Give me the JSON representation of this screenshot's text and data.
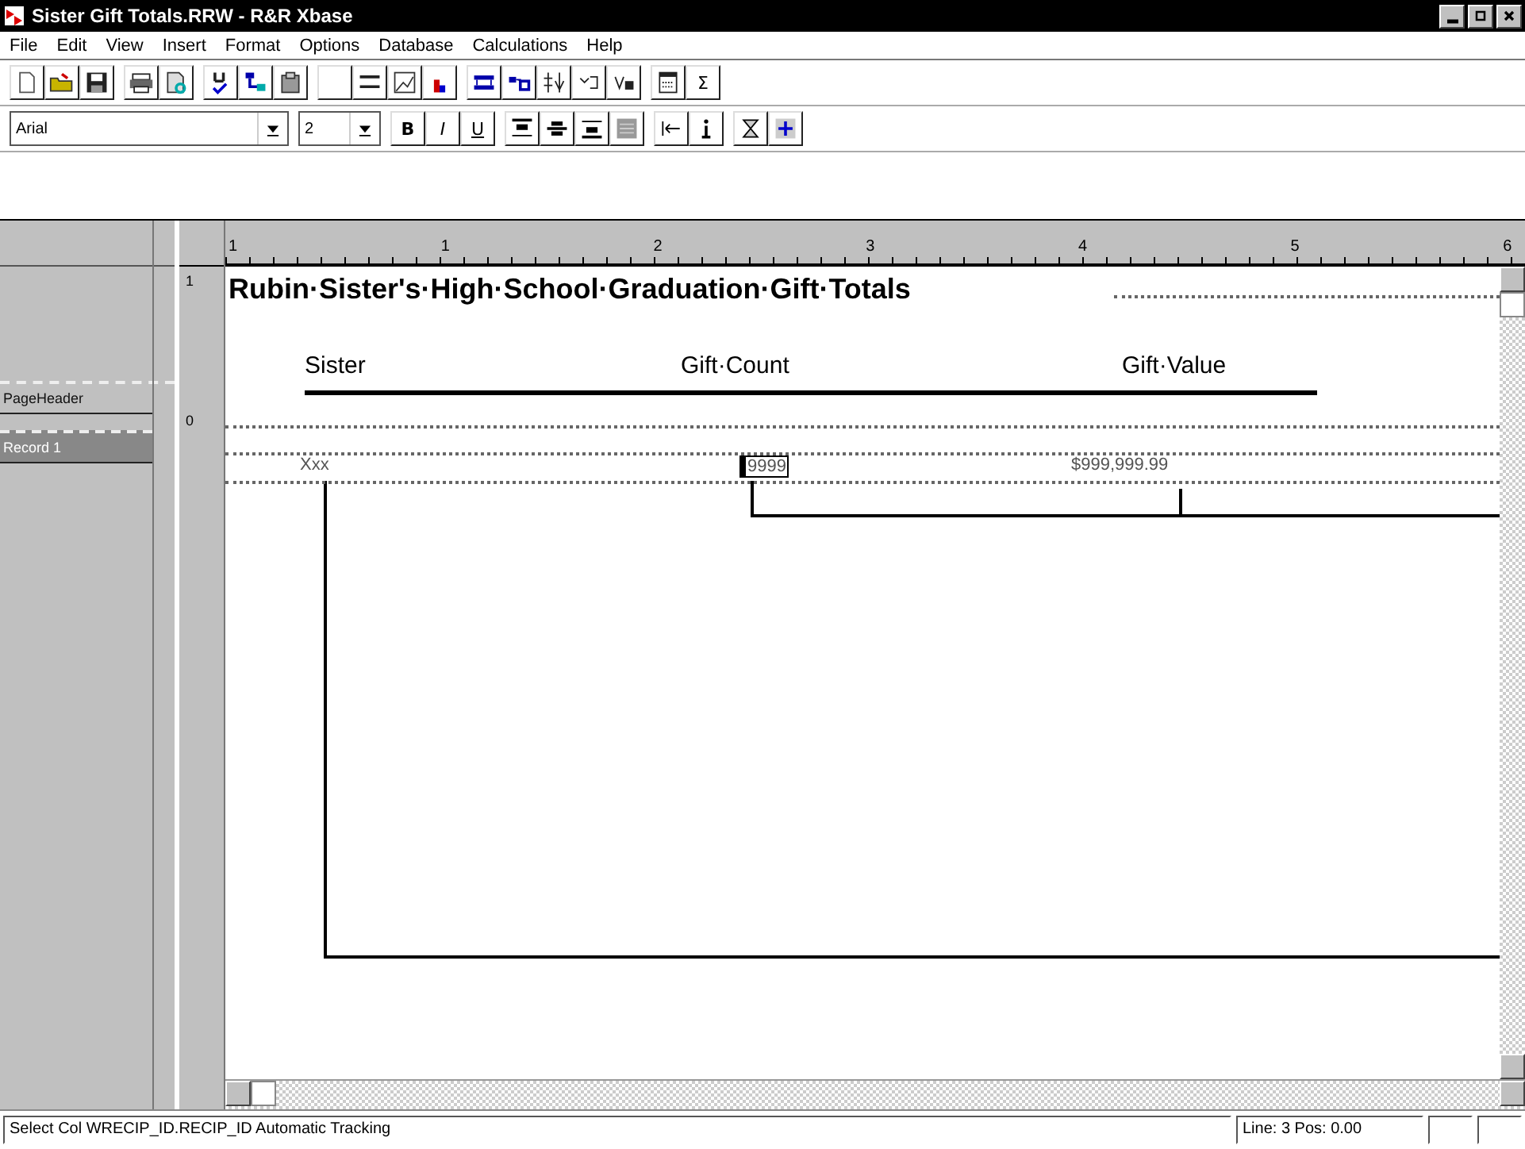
{
  "window": {
    "title": "Sister Gift Totals.RRW - R&R Xbase"
  },
  "menu": [
    "File",
    "Edit",
    "View",
    "Insert",
    "Format",
    "Options",
    "Database",
    "Calculations",
    "Help"
  ],
  "format_bar": {
    "font": "Arial",
    "size": "2",
    "bold": "B",
    "italic": "I",
    "underline": "U"
  },
  "toolbar_sum": "Σ",
  "ruler": {
    "marks": [
      "1",
      "1",
      "2",
      "3",
      "4",
      "5",
      "6"
    ],
    "side_marks": [
      "1",
      "0"
    ]
  },
  "bands": [
    {
      "label": "PageHeader",
      "selected": false
    },
    {
      "label": "Record 1",
      "selected": true
    }
  ],
  "report": {
    "title": "Rubin·Sister's·High·School·Graduation·Gift·Totals",
    "headers": [
      "Sister",
      "Gift·Count",
      "Gift·Value"
    ],
    "fields": [
      "Xxx",
      "9999",
      "$999,999.99"
    ]
  },
  "status_bar": {
    "message": "Select Col WRECIP_ID.RECIP_ID Automatic Tracking",
    "position": "Line: 3 Pos: 0.00"
  }
}
